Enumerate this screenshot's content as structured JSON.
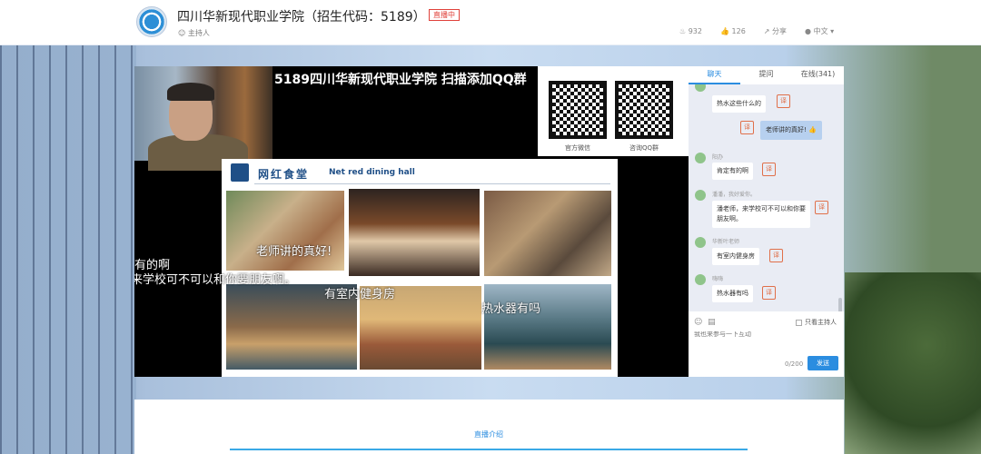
{
  "header": {
    "title": "四川华新现代职业学院（招生代码：5189）",
    "live_badge": "直播中",
    "host_label": "主持人",
    "views": "932",
    "likes": "126",
    "share": "分享",
    "language": "中文"
  },
  "player": {
    "stream_title": "5189四川华新现代职业学院 扫描添加QQ群",
    "qr": [
      "官方微信",
      "咨询QQ群"
    ],
    "slide": {
      "title_cn": "网红食堂",
      "title_en": "Net red dining hall"
    },
    "danmaku": [
      "有的啊",
      "来学校可不可以和你要朋友啊。",
      "老师讲的真好!",
      "有室内健身房",
      "热水器有吗"
    ]
  },
  "chat": {
    "tabs": [
      "聊天",
      "提问",
      "在线(341)"
    ],
    "messages": [
      {
        "name": "",
        "text": "热水这些什么的"
      },
      {
        "name": "",
        "text": "老师讲的真好!"
      },
      {
        "name": "阳办",
        "text": "肯定有的啊"
      },
      {
        "name": "潘潘，我好爱你。",
        "text": "潘老师，来学校可不可以和你要朋友啊。"
      },
      {
        "name": "华新叶老师",
        "text": "有室内健身房"
      },
      {
        "name": "嗨嗨",
        "text": "热水器有吗"
      }
    ],
    "only_host": "只看主持人",
    "input_placeholder": "我也来参与一下互动",
    "char_count": "0/200",
    "send": "发送",
    "translate_icon": "译"
  },
  "bottom": {
    "intro_tab": "直播介绍"
  },
  "colors": {
    "accent": "#2b8de0",
    "live": "#e0413a"
  }
}
